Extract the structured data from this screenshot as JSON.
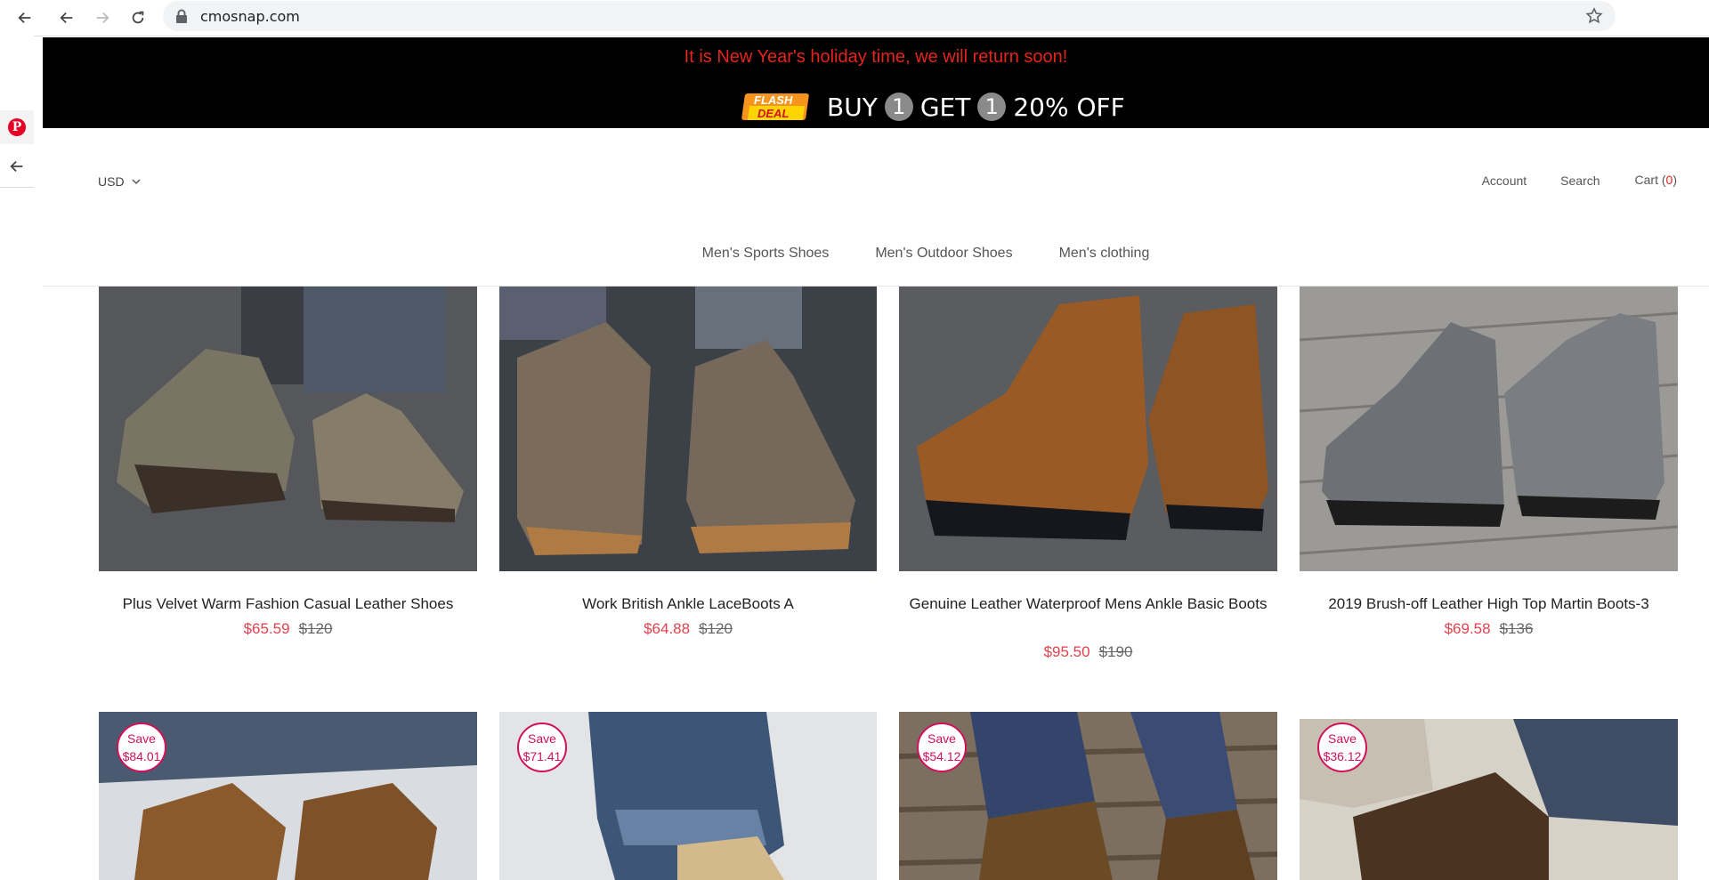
{
  "browser": {
    "url": "cmosnap.com"
  },
  "announcement": {
    "message": "It is New Year's holiday time, we will return soon!",
    "flash_line1": "FLASH",
    "flash_line2": "DEAL",
    "promo_buy": "BUY",
    "promo_num1": "1",
    "promo_get": "GET",
    "promo_num2": "1",
    "promo_off": "20% OFF"
  },
  "header": {
    "currency": "USD",
    "account": "Account",
    "search": "Search",
    "cart_label": "Cart (",
    "cart_count": "0",
    "cart_close": ")"
  },
  "nav": {
    "items": [
      "Men's Sports Shoes",
      "Men's Outdoor Shoes",
      "Men's clothing"
    ]
  },
  "products": [
    {
      "title": "Plus Velvet Warm Fashion Casual Leather Shoes",
      "price": "$65.59",
      "compare": "$120"
    },
    {
      "title": "Work British Ankle LaceBoots A",
      "price": "$64.88",
      "compare": "$120"
    },
    {
      "title": "Genuine Leather Waterproof Mens Ankle Basic Boots",
      "price": "$95.50",
      "compare": "$190"
    },
    {
      "title": "2019 Brush-off Leather High Top Martin Boots-3",
      "price": "$69.58",
      "compare": "$136"
    }
  ],
  "row2": [
    {
      "save_label": "Save",
      "save_amount": "$84.01"
    },
    {
      "save_label": "Save",
      "save_amount": "$71.41"
    },
    {
      "save_label": "Save",
      "save_amount": "$54.12"
    },
    {
      "save_label": "Save",
      "save_amount": "$36.12"
    }
  ]
}
